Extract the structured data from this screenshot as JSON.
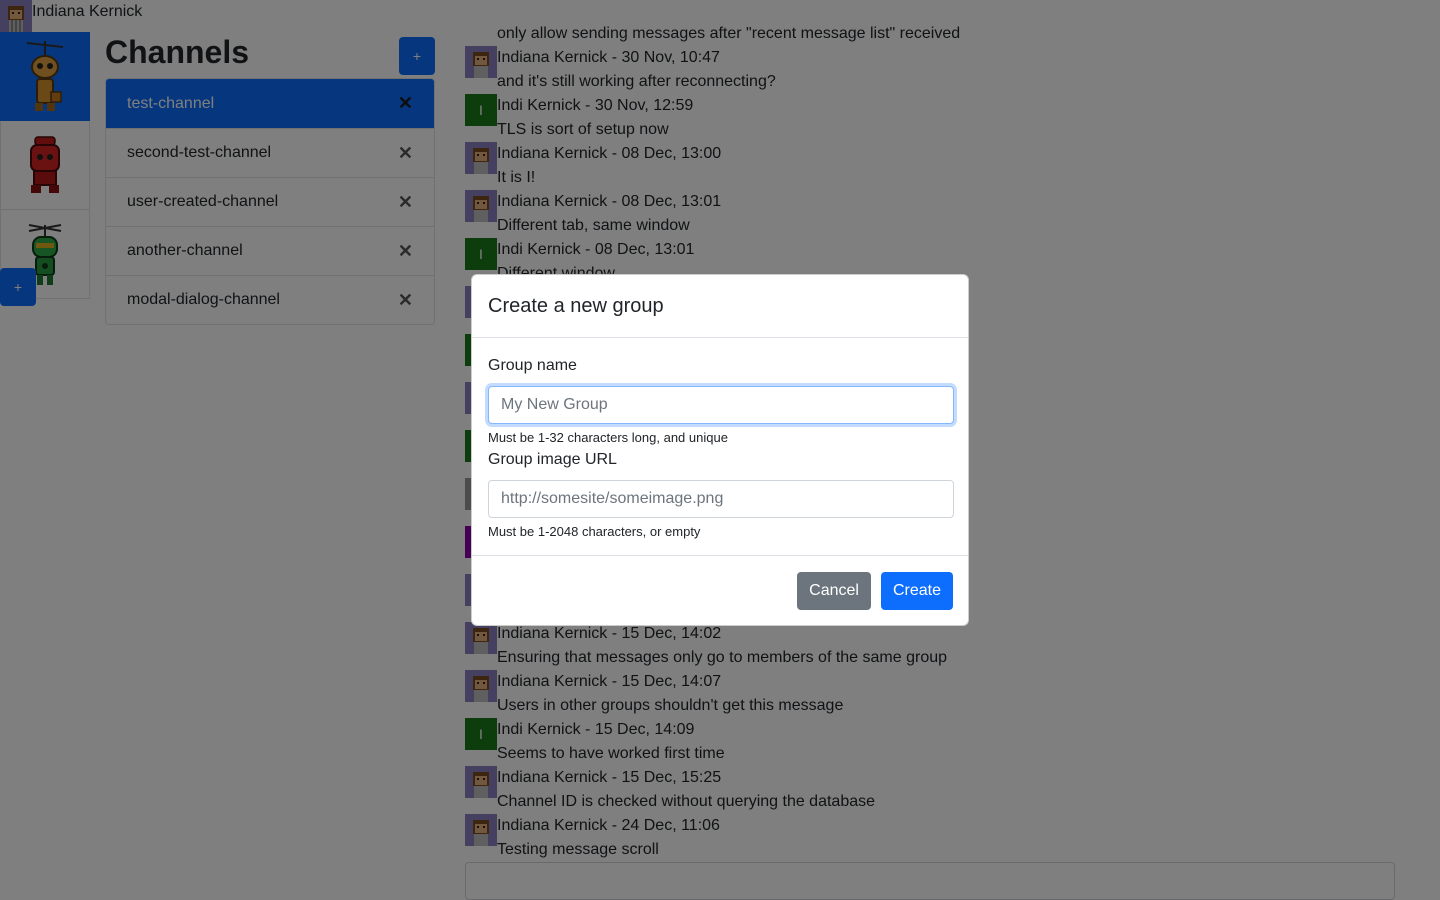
{
  "user": {
    "name": "Indiana Kernick"
  },
  "groups": {
    "add_label": "+"
  },
  "channels": {
    "title": "Channels",
    "add_label": "+",
    "close_glyph": "✕",
    "items": [
      {
        "label": "test-channel"
      },
      {
        "label": "second-test-channel"
      },
      {
        "label": "user-created-channel"
      },
      {
        "label": "another-channel"
      },
      {
        "label": "modal-dialog-channel"
      }
    ]
  },
  "messages": [
    {
      "header": "",
      "body": "only allow sending messages after \"recent message list\" received"
    },
    {
      "header": "Indiana Kernick - 30 Nov, 10:47",
      "body": "and it's still working after reconnecting?",
      "avatar": "robot"
    },
    {
      "header": "Indi Kernick - 30 Nov, 12:59",
      "body": "TLS is sort of setup now",
      "avatar": "letter",
      "letter": "I"
    },
    {
      "header": "Indiana Kernick - 08 Dec, 13:00",
      "body": "It is I!",
      "avatar": "robot"
    },
    {
      "header": "Indiana Kernick - 08 Dec, 13:01",
      "body": "Different tab, same window",
      "avatar": "robot"
    },
    {
      "header": "Indi Kernick - 08 Dec, 13:01",
      "body": "Different window",
      "avatar": "letter",
      "letter": "I"
    },
    {
      "header": "Indiana Kernick - 15 Dec, 14:02",
      "body": "Ensuring that messages only go to members of the same group",
      "avatar": "robot"
    },
    {
      "header": "Indiana Kernick - 15 Dec, 14:07",
      "body": "Users in other groups shouldn't get this message",
      "avatar": "robot"
    },
    {
      "header": "Indi Kernick - 15 Dec, 14:09",
      "body": "Seems to have worked first time",
      "avatar": "letter",
      "letter": "I"
    },
    {
      "header": "Indiana Kernick - 15 Dec, 15:25",
      "body": "Channel ID is checked without querying the database",
      "avatar": "robot"
    },
    {
      "header": "Indiana Kernick - 24 Dec, 11:06",
      "body": "Testing message scroll",
      "avatar": "robot"
    }
  ],
  "modal": {
    "title": "Create a new group",
    "group_name_label": "Group name",
    "group_name_placeholder": "My New Group",
    "group_name_value": "",
    "group_name_hint": "Must be 1-32 characters long, and unique",
    "image_url_label": "Group image URL",
    "image_url_placeholder": "http://somesite/someimage.png",
    "image_url_value": "",
    "image_url_hint": "Must be 1-2048 characters, or empty",
    "cancel_label": "Cancel",
    "create_label": "Create"
  },
  "colors": {
    "primary": "#0d6efd",
    "secondary": "#6c757d",
    "avatar_green": "#1a7a1a"
  }
}
